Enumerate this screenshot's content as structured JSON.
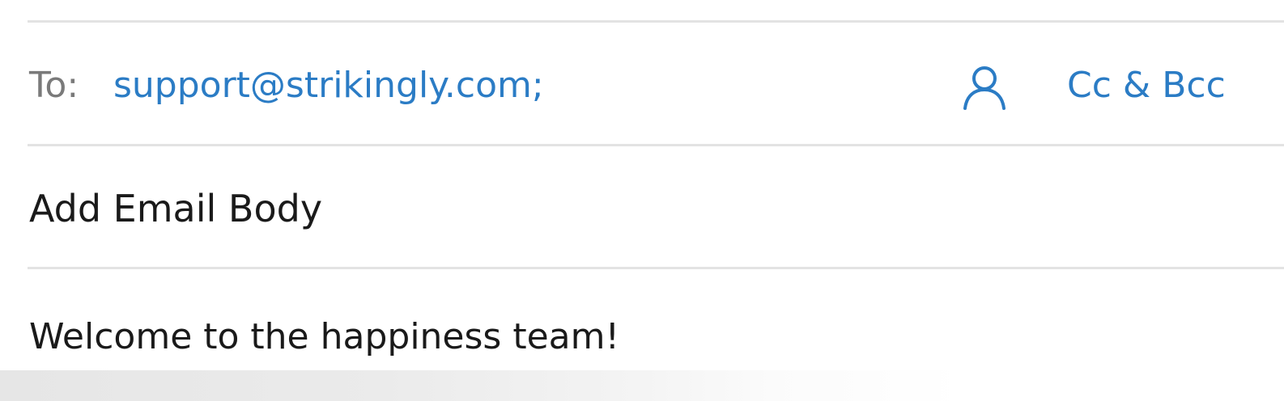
{
  "recipients": {
    "to_label": "To:",
    "address": "support@strikingly.com;",
    "contact_icon": "person-icon",
    "cc_bcc_label": "Cc & Bcc"
  },
  "subject_line": "Add Email Body",
  "message_body": "Welcome to the happiness team!",
  "colors": {
    "accent": "#2b7cc5",
    "label": "#7a7a7a",
    "text": "#1a1a1a",
    "divider": "#e3e3e3"
  }
}
